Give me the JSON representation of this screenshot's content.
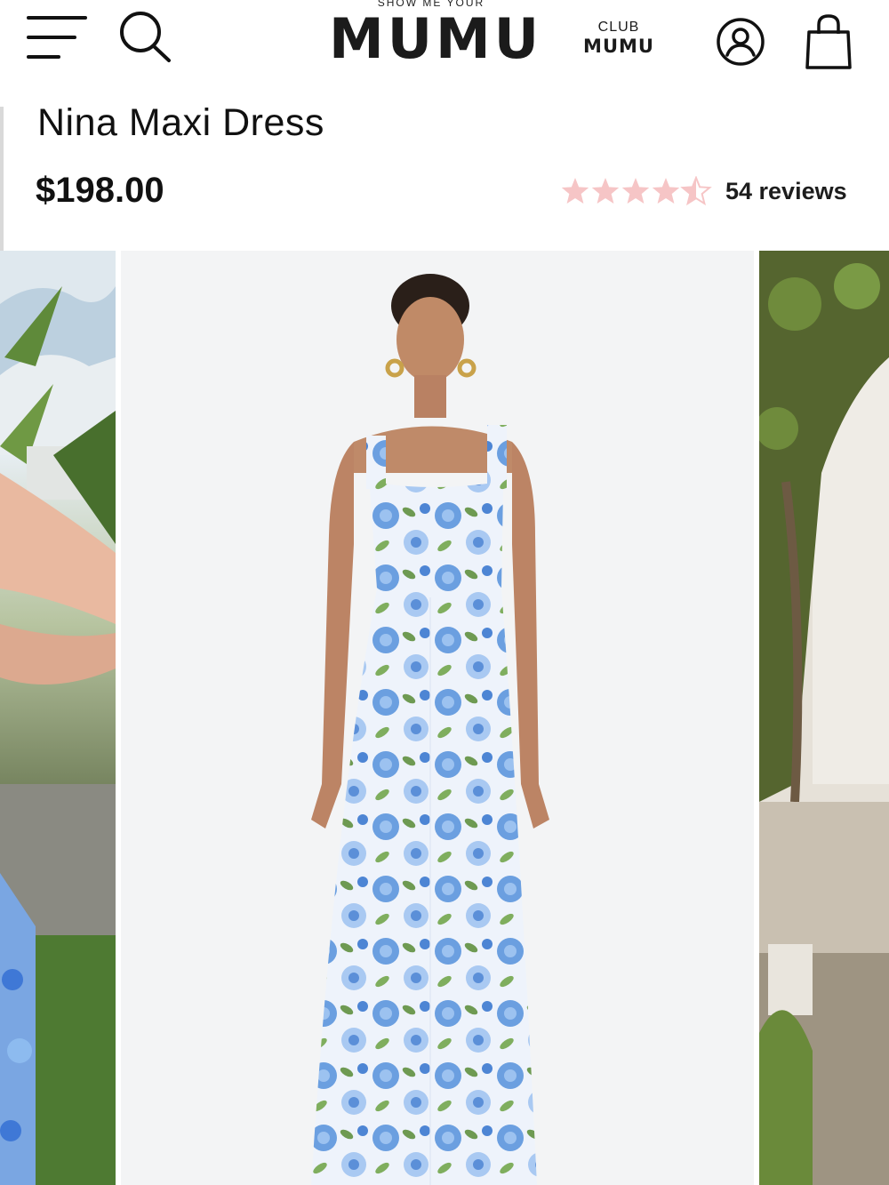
{
  "header": {
    "logo_top": "SHOW ME YOUR",
    "logo_main": "MUMU",
    "club_top": "CLUB",
    "club_bottom": "MUMU",
    "icons": [
      "menu-icon",
      "search-icon",
      "account-icon",
      "cart-icon"
    ]
  },
  "product": {
    "title": "Nina Maxi Dress",
    "price": "$198.00",
    "rating": 4.5,
    "rating_max": 5,
    "reviews_label": "54 reviews"
  },
  "colors": {
    "star": "#f6c5c6",
    "text": "#111111",
    "dress_blue": "#6b9fe0",
    "dress_green": "#6e9a52"
  },
  "gallery": {
    "slides": [
      "side-photo-left",
      "main-photo-studio",
      "side-photo-right"
    ],
    "active_index": 1
  }
}
